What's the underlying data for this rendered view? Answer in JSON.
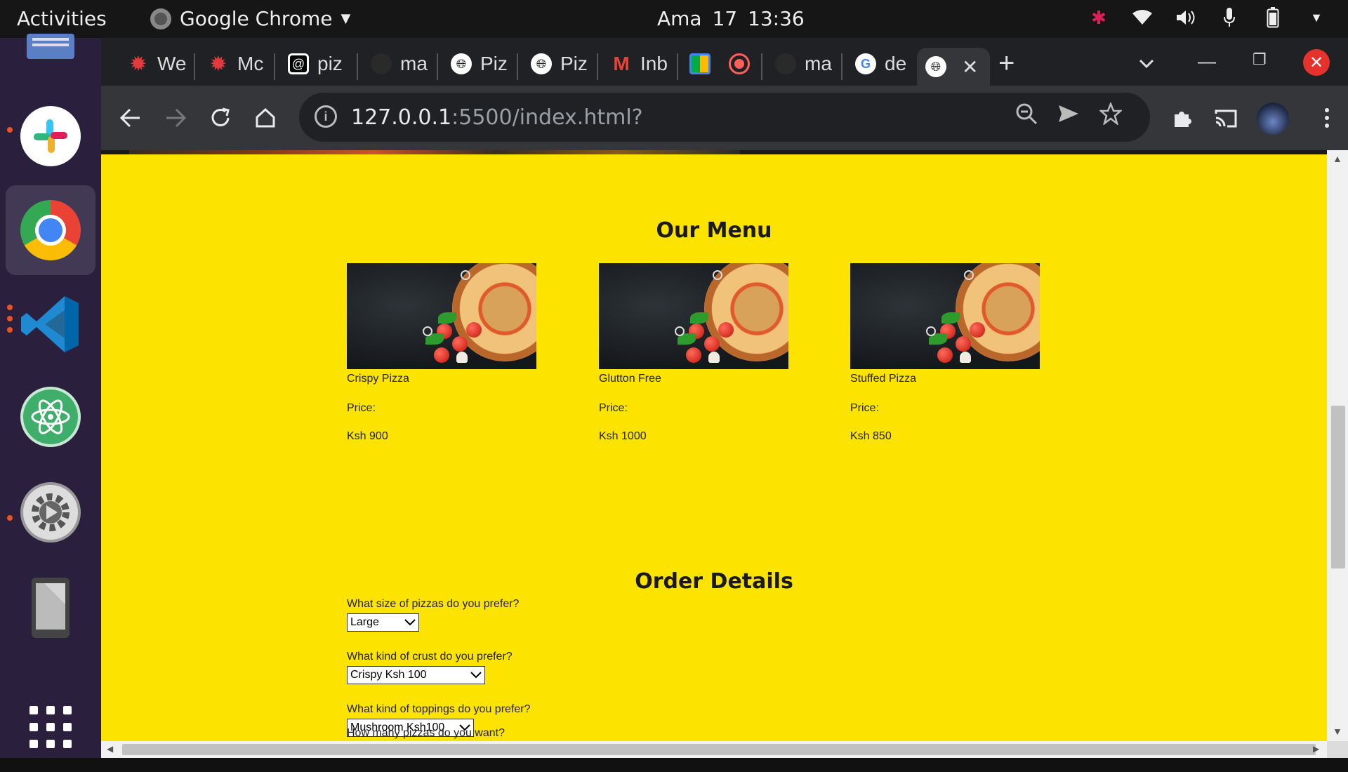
{
  "system": {
    "activities": "Activities",
    "app_name": "Google Chrome",
    "clock": "Ama 17  13:36"
  },
  "browser": {
    "tabs": [
      {
        "label": "We",
        "icon": "red-gear-icon",
        "color": "#e33b3b"
      },
      {
        "label": "Mc",
        "icon": "red-gear-icon",
        "color": "#e33b3b"
      },
      {
        "label": "piz",
        "icon": "swirl-icon",
        "color": "#ffffff"
      },
      {
        "label": "ma",
        "icon": "github-icon",
        "color": "#333333"
      },
      {
        "label": "Piz",
        "icon": "globe-icon",
        "color": "#ffffff"
      },
      {
        "label": "Piz",
        "icon": "globe-icon",
        "color": "#ffffff"
      },
      {
        "label": "Inb",
        "icon": "gmail-icon",
        "color": "#ea4335"
      },
      {
        "label": "",
        "icon": "meet-icon",
        "color": "#00ac47"
      },
      {
        "label": "",
        "icon": "record-icon",
        "color": "#ff5f57"
      },
      {
        "label": "ma",
        "icon": "github-icon",
        "color": "#333333"
      },
      {
        "label": "de",
        "icon": "google-icon",
        "color": "#4285f4"
      }
    ],
    "active_tab": {
      "label": "",
      "icon": "globe-icon"
    },
    "url_host": "127.0.0.1",
    "url_rest": ":5500/index.html?"
  },
  "page": {
    "menu_title": "Our Menu",
    "items": [
      {
        "name": "Crispy Pizza",
        "price_label": "Price:",
        "price": "Ksh 900"
      },
      {
        "name": "Glutton Free",
        "price_label": "Price:",
        "price": "Ksh 1000"
      },
      {
        "name": "Stuffed Pizza",
        "price_label": "Price:",
        "price": "Ksh 850"
      }
    ],
    "order_title": "Order Details",
    "questions": {
      "size": "What size of pizzas do you prefer?",
      "crust": "What kind of crust do you prefer?",
      "toppings": "What kind of toppings do you prefer?",
      "quantity": "How many pizzas do you want?"
    },
    "selects": {
      "size": "Large",
      "crust": "Crispy Ksh 100",
      "toppings": "Mushroom Ksh100"
    },
    "background_color": "#fde400"
  }
}
